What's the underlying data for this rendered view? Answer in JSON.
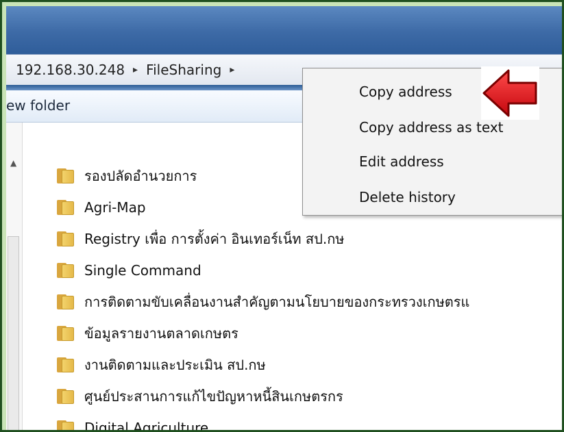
{
  "address_bar": {
    "breadcrumbs": [
      "192.168.30.248",
      "FileSharing"
    ],
    "separator": "▸"
  },
  "toolbar": {
    "new_folder_label": "ew folder"
  },
  "files": [
    "รองปลัดอำนวยการ",
    "Agri-Map",
    "Registry เพื่อ การตั้งค่า อินเทอร์เน็ท สป.กษ",
    "Single Command",
    "การติดตามขับเคลื่อนงานสำคัญตามนโยบายของกระทรวงเกษตรแ",
    "ข้อมูลรายงานตลาดเกษตร",
    "งานติดตามและประเมิน สป.กษ",
    "ศูนย์ประสานการแก้ไขปัญหาหนี้สินเกษตรกร",
    "Digital Agriculture"
  ],
  "context_menu": {
    "items": [
      "Copy address",
      "Copy address as text",
      "Edit address",
      "Delete history"
    ]
  },
  "annotation": {
    "arrow_color": "#e1141b",
    "arrow_direction": "left"
  },
  "colors": {
    "border_frame": "#1f4f1f",
    "background": "#c9e4b7",
    "title_bar": "#3d6aa6"
  }
}
